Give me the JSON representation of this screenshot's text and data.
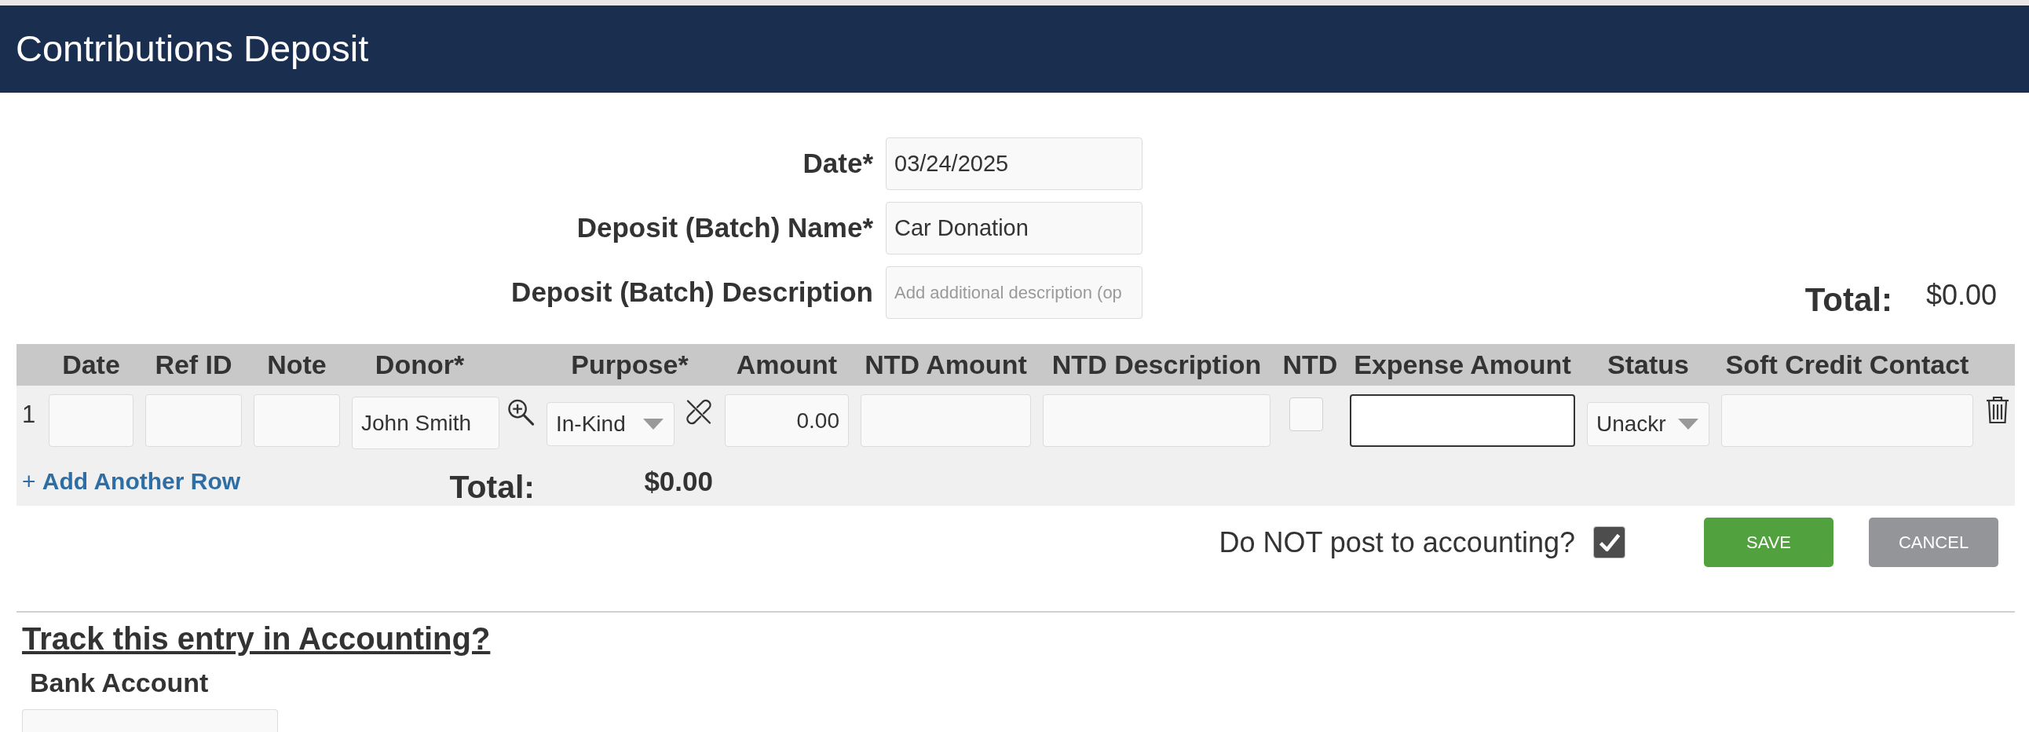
{
  "page_header": {
    "title": "Contributions Deposit"
  },
  "deposit_form": {
    "fields": [
      {
        "label": "Date*",
        "value": "03/24/2025"
      },
      {
        "label": "Deposit (Batch) Name*",
        "value": "Car Donation"
      },
      {
        "label": "Deposit (Batch) Description",
        "placeholder": "Add additional description (op"
      }
    ],
    "total": {
      "label": "Total:",
      "value": "$0.00"
    }
  },
  "contributions_table": {
    "columns": [
      "Date",
      "Ref ID",
      "Note",
      "Donor*",
      "Purpose*",
      "Amount",
      "NTD Amount",
      "NTD Description",
      "NTD",
      "Expense Amount",
      "Status",
      "Soft Credit Contact"
    ],
    "rows": [
      {
        "number": "1",
        "cells": [
          {
            "kind": "text",
            "focused": false
          },
          {
            "kind": "text",
            "focused": false
          },
          {
            "kind": "text",
            "focused": false
          },
          {
            "kind": "lookup",
            "value": "John Smith",
            "focused": false
          },
          {
            "kind": "select",
            "value": "In-Kind",
            "unlink": true
          },
          {
            "kind": "amount",
            "value": "0.00",
            "focused": false
          },
          {
            "kind": "text",
            "focused": false
          },
          {
            "kind": "text",
            "focused": false
          },
          {
            "kind": "checkbox",
            "checked": false
          },
          {
            "kind": "text",
            "focused": true
          },
          {
            "kind": "select",
            "value": "Unackr",
            "unlink": false
          },
          {
            "kind": "text",
            "focused": false
          }
        ]
      }
    ],
    "add_row_link": "+ **Add Another Row**",
    "total": {
      "label": "Total:",
      "value": "$0.00"
    }
  },
  "accounting_opt_out": {
    "label": "Do NOT post to accounting?",
    "checked": true
  },
  "buttons": [
    {
      "label": "SAVE",
      "kind": "primary"
    },
    {
      "label": "CANCEL",
      "kind": "secondary"
    }
  ],
  "accounting_section": {
    "title": "Track this entry in Accounting?",
    "bank_account_label": "Bank Account"
  }
}
